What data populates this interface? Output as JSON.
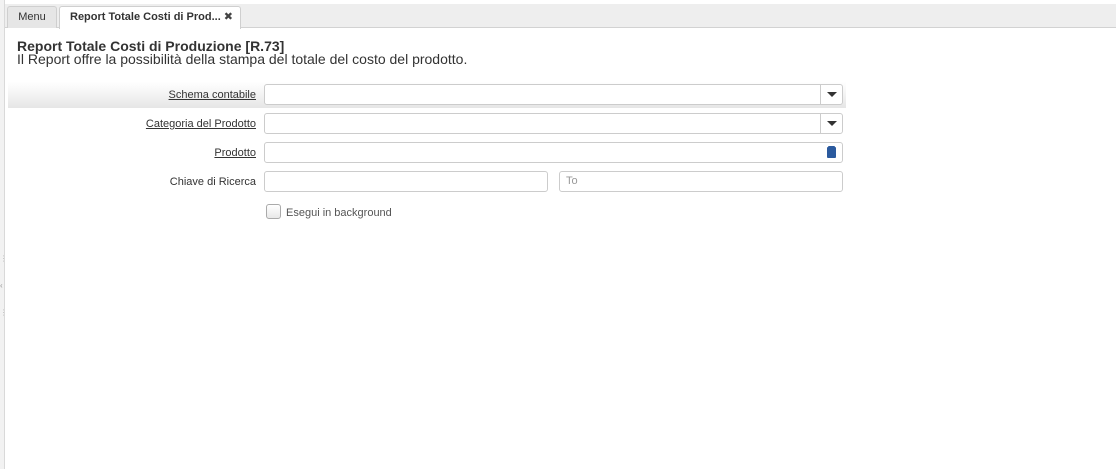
{
  "tabs": [
    {
      "label": "Menu"
    },
    {
      "label": "Report Totale Costi di Prod...",
      "close": "✖"
    }
  ],
  "report": {
    "title": "Report Totale Costi di Produzione [R.73]",
    "description": "Il Report offre la possibilità della stampa del totale del costo del prodotto."
  },
  "form": {
    "schema_contabile": {
      "label": "Schema contabile",
      "value": "",
      "icon": "chevron-down-icon"
    },
    "categoria_prodotto": {
      "label": "Categoria del Prodotto",
      "value": "",
      "icon": "chevron-down-icon"
    },
    "prodotto": {
      "label": "Prodotto",
      "value": "",
      "icon": "lookup-icon"
    },
    "chiave_ricerca": {
      "label": "Chiave di Ricerca",
      "from_value": "",
      "to_placeholder": "To"
    },
    "background": {
      "label": "Esegui in background",
      "checked": false
    }
  },
  "left_rail_marks": [
    "⋮",
    "‹",
    "⋮"
  ]
}
